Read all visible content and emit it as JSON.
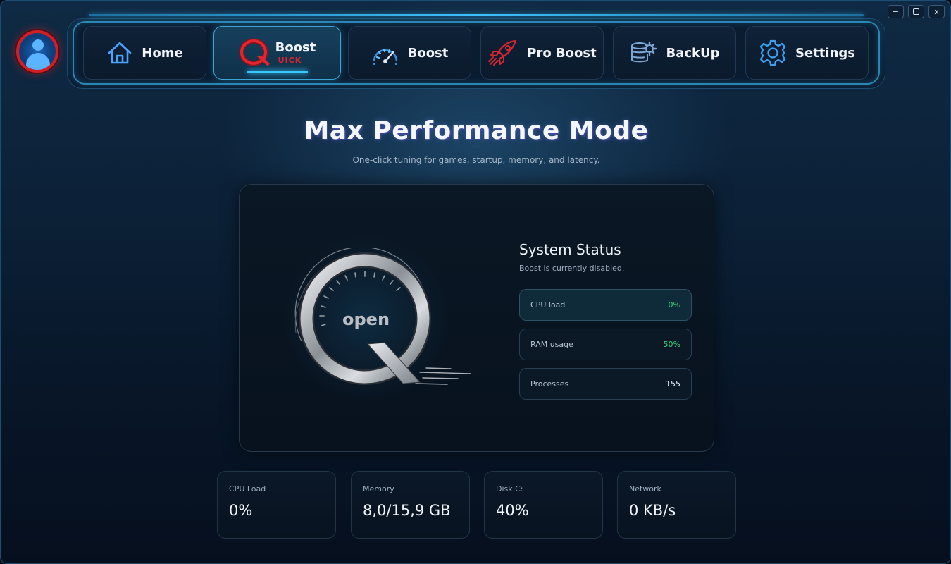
{
  "window_controls": {
    "minimize": "−",
    "maximize": "□",
    "close": "x"
  },
  "nav": {
    "tabs": [
      {
        "label": "Home",
        "icon": "home-icon"
      },
      {
        "label": "Boost",
        "sublabel": "UICK",
        "icon": "quick-boost-q-logo",
        "active": true
      },
      {
        "label": "Boost",
        "icon": "speedometer-icon"
      },
      {
        "label": "Pro Boost",
        "icon": "rocket-icon"
      },
      {
        "label": "BackUp",
        "icon": "database-gear-icon"
      },
      {
        "label": "Settings",
        "icon": "gear-icon"
      }
    ]
  },
  "header": {
    "title": "Max Performance Mode",
    "subtitle": "One-click tuning for games, startup, memory, and latency."
  },
  "gauge": {
    "label": "open"
  },
  "status": {
    "title": "System Status",
    "subtitle": "Boost is currently disabled.",
    "rows": [
      {
        "label": "CPU load",
        "value": "0%"
      },
      {
        "label": "RAM usage",
        "value": "50%"
      },
      {
        "label": "Processes",
        "value": "155"
      }
    ]
  },
  "metrics": [
    {
      "label": "CPU Load",
      "value": "0%"
    },
    {
      "label": "Memory",
      "value": "8,0/15,9 GB"
    },
    {
      "label": "Disk C:",
      "value": "40%"
    },
    {
      "label": "Network",
      "value": "0 KB/s"
    }
  ],
  "colors": {
    "accent": "#36c8ff",
    "brand_red": "#e2222b",
    "positive": "#36d67a"
  }
}
